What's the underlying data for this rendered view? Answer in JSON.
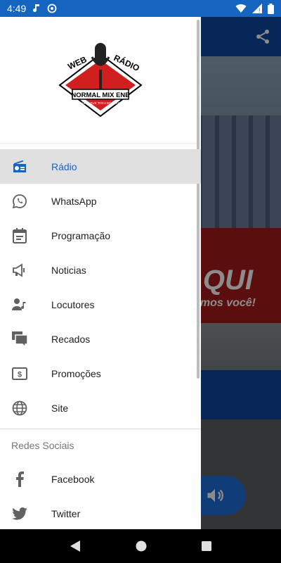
{
  "status_bar": {
    "time": "4:49"
  },
  "background": {
    "banner_text": "QUI",
    "banner_subtext": "mos você!"
  },
  "drawer": {
    "logo_text": "WEB RÁDIO NORMAL MIX ENE",
    "menu_items": [
      {
        "label": "Rádio",
        "icon": "radio-icon",
        "active": true
      },
      {
        "label": "WhatsApp",
        "icon": "whatsapp-icon",
        "active": false
      },
      {
        "label": "Programação",
        "icon": "calendar-icon",
        "active": false
      },
      {
        "label": "Noticias",
        "icon": "megaphone-icon",
        "active": false
      },
      {
        "label": "Locutores",
        "icon": "person-music-icon",
        "active": false
      },
      {
        "label": "Recados",
        "icon": "chat-icon",
        "active": false
      },
      {
        "label": "Promoções",
        "icon": "dollar-icon",
        "active": false
      },
      {
        "label": "Site",
        "icon": "globe-icon",
        "active": false
      }
    ],
    "social_section_title": "Redes Sociais",
    "social_items": [
      {
        "label": "Facebook",
        "icon": "facebook-icon"
      },
      {
        "label": "Twitter",
        "icon": "twitter-icon"
      }
    ]
  },
  "colors": {
    "accent": "#1565c0",
    "status_bar": "#1565c0",
    "active_bg": "#e0e0e0"
  }
}
